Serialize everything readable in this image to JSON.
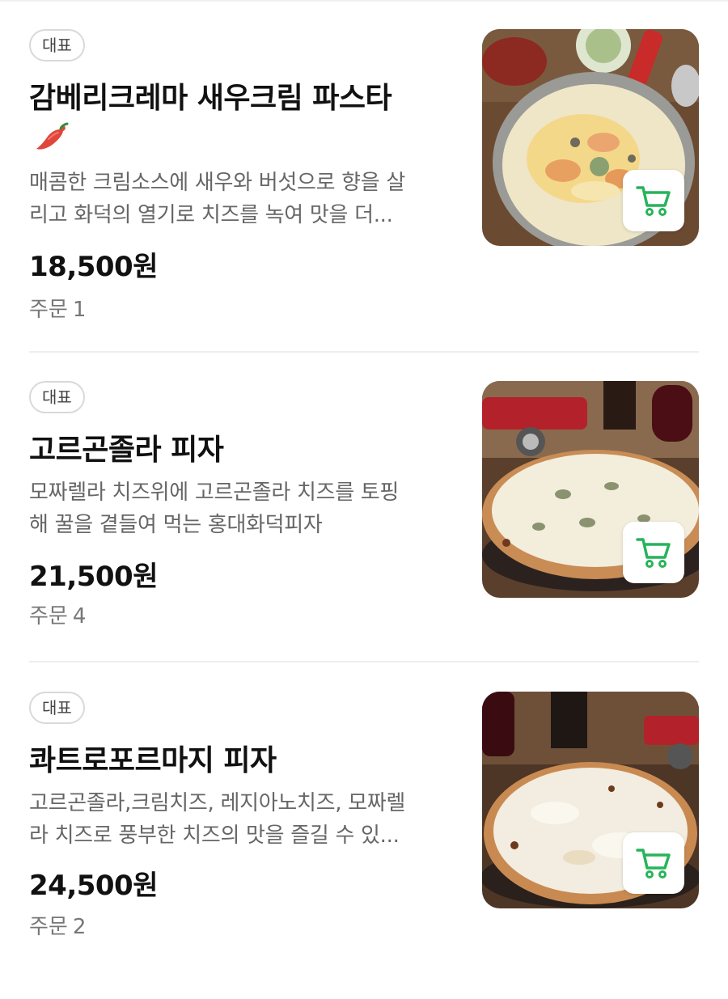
{
  "colors": {
    "cart_green": "#27b45a",
    "chili_red": "#e0463c",
    "badge_border": "#d9d9d9",
    "desc_gray": "#666666",
    "divider": "#eeeeee"
  },
  "menu": [
    {
      "badge": "대표",
      "name": "감베리크레마 새우크림 파스타",
      "spicy_icon": "chili-pepper-icon",
      "desc_lines": [
        "매콤한 크림소스에 새우와 버섯으로 향을 살",
        "리고 화덕의 열기로 치즈를 녹여 맛을 더..."
      ],
      "price": "18,500원",
      "orders_label": "주문",
      "orders_count": "1",
      "image": "shrimp-cream-pasta-photo",
      "cart_icon": "cart-icon"
    },
    {
      "badge": "대표",
      "name": "고르곤졸라 피자",
      "desc_lines": [
        "모짜렐라 치즈위에 고르곤졸라 치즈를 토핑",
        "해 꿀을 곁들여 먹는 홍대화덕피자"
      ],
      "price": "21,500원",
      "orders_label": "주문",
      "orders_count": "4",
      "image": "gorgonzola-pizza-photo",
      "cart_icon": "cart-icon"
    },
    {
      "badge": "대표",
      "name": "콰트로포르마지 피자",
      "desc_lines": [
        "고르곤졸라,크림치즈, 레지아노치즈, 모짜렐",
        "라 치즈로 풍부한 치즈의 맛을 즐길 수 있..."
      ],
      "price": "24,500원",
      "orders_label": "주문",
      "orders_count": "2",
      "image": "quattro-formaggi-pizza-photo",
      "cart_icon": "cart-icon"
    }
  ]
}
